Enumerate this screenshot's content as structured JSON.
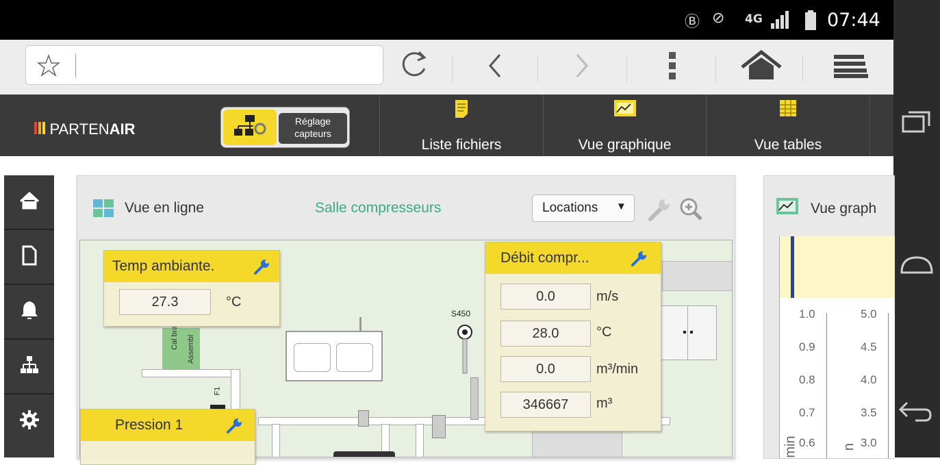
{
  "status_bar": {
    "time": "07:44",
    "network": "4G",
    "icons": [
      "bluetooth-icon",
      "vibrate-icon",
      "signal-icon",
      "battery-icon"
    ]
  },
  "browser": {
    "url_value": "",
    "icons": [
      "star-icon",
      "reload-icon",
      "back-icon",
      "forward-icon",
      "overflow-menu-icon",
      "home-icon",
      "tabs-icon"
    ]
  },
  "app": {
    "logo_light": "PARTEN",
    "logo_bold": "AIR",
    "settings_button": {
      "line1": "Réglage",
      "line2": "capteurs"
    },
    "tabs": [
      {
        "label": "Liste fichiers",
        "icon": "file-list-icon"
      },
      {
        "label": "Vue graphique",
        "icon": "chart-view-icon"
      },
      {
        "label": "Vue tables",
        "icon": "table-view-icon"
      }
    ]
  },
  "sidebar": {
    "items": [
      "home-icon",
      "document-icon",
      "bell-icon",
      "network-icon",
      "gear-icon"
    ]
  },
  "panel": {
    "title": "Vue en ligne",
    "location_title": "Salle compresseurs",
    "locations_label": "Locations",
    "sensors": {
      "temp": {
        "title": "Temp ambiante.",
        "value": "27.3",
        "unit": "°C"
      },
      "flow": {
        "title": "Débit compr...",
        "rows": [
          {
            "value": "0.0",
            "unit": "m/s"
          },
          {
            "value": "28.0",
            "unit": "°C"
          },
          {
            "value": "0.0",
            "unit": "m³/min"
          },
          {
            "value": "346667",
            "unit": "m³"
          }
        ]
      },
      "pressure": {
        "title": "Pression 1"
      }
    },
    "diagram_labels": {
      "device": "S450",
      "pipe_a": "Cal brati",
      "pipe_b": "Assembl",
      "valve": "F1"
    }
  },
  "graph_panel": {
    "title": "Vue graph",
    "axis1_ticks": [
      "1.0",
      "0.9",
      "0.8",
      "0.7",
      "0.6"
    ],
    "axis2_ticks": [
      "5.0",
      "4.5",
      "4.0",
      "3.5",
      "3.0"
    ],
    "axis1_unit": "min",
    "axis2_unit": "n"
  },
  "colors": {
    "accent_yellow": "#f4d92b",
    "header_dark": "#3a3a3a",
    "teal_text": "#3aaa8a",
    "diagram_bg": "#e8f0e2"
  }
}
